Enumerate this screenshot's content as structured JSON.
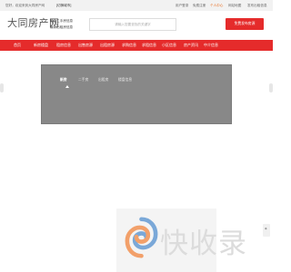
{
  "topbar": {
    "greeting": "您好，欢迎来到大同房产网",
    "switch_city": "[切换城市]",
    "links": [
      "用户登录",
      "免费注册",
      "个人中心",
      "网站地图",
      "发布出租信息"
    ]
  },
  "header": {
    "logo_text": "大同房产网",
    "sub_links": [
      "最新二手房信息",
      "最新出租房信息"
    ],
    "search_placeholder": "请输入您要查找的关键字",
    "post_button": "免费发布房源"
  },
  "nav": {
    "items": [
      "首页",
      "新房楼盘",
      "租房信息",
      "出售房源",
      "出租房源",
      "求购信息",
      "求租信息",
      "小区信息",
      "房产资讯",
      "中介信息"
    ]
  },
  "banner": {
    "tabs": [
      "新房",
      "二手房",
      "出租房",
      "楼盘信息"
    ],
    "active_tab": "新房"
  },
  "watermark": {
    "text": "快收录"
  },
  "side": {
    "scroll_label": "◆"
  },
  "colors": {
    "accent": "#e52b2b",
    "banner": "#888888",
    "topbar": "#f2f2f2"
  }
}
